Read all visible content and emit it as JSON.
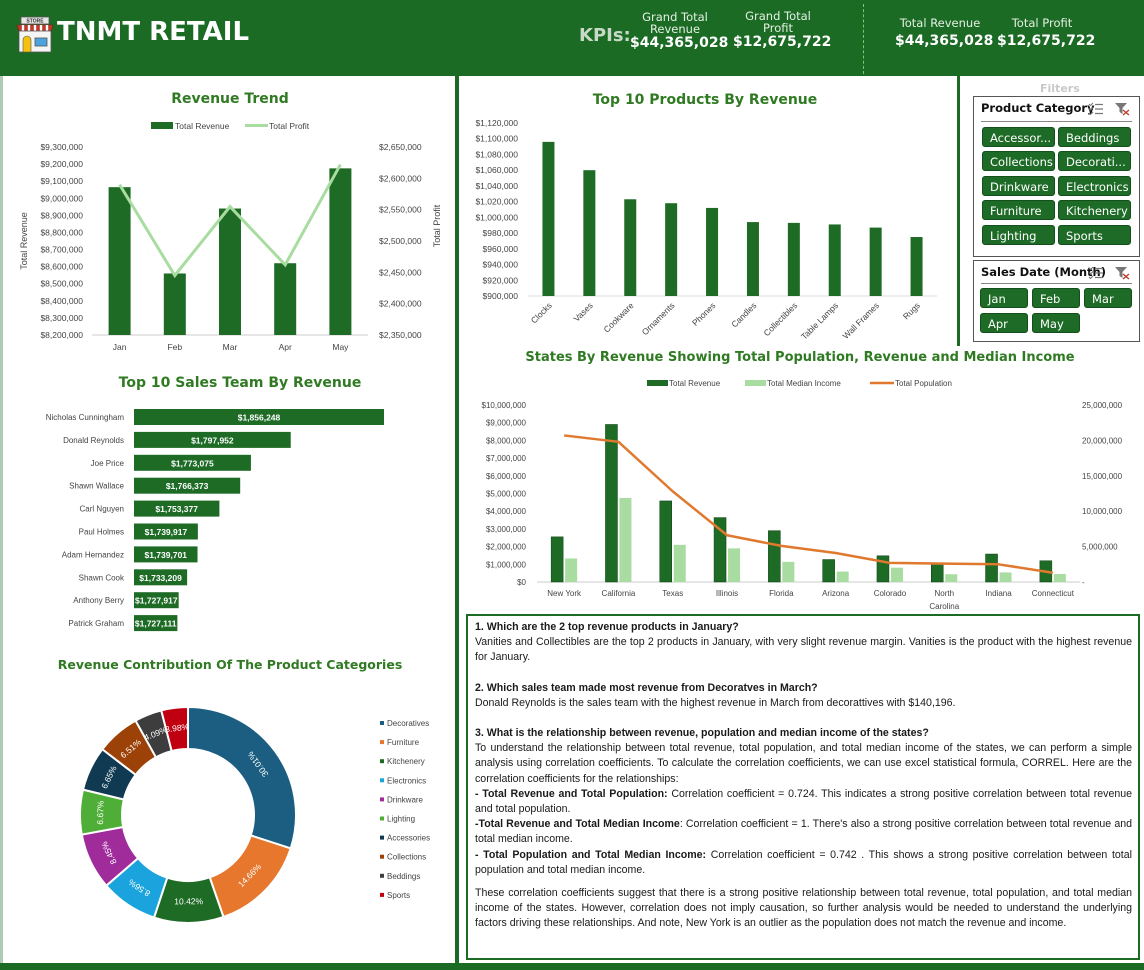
{
  "header": {
    "brand": "TNMT RETAIL",
    "logo_icon": "store-icon",
    "kpis_label": "KPIs:",
    "kpis": [
      {
        "label_line1": "Grand Total",
        "label_line2": "Revenue",
        "value": "$44,365,028"
      },
      {
        "label_line1": "Grand Total",
        "label_line2": "Profit",
        "value": "$12,675,722"
      },
      {
        "label_line1": "Total Revenue",
        "label_line2": "",
        "value": "$44,365,028"
      },
      {
        "label_line1": "Total Profit",
        "label_line2": "",
        "value": "$12,675,722"
      }
    ]
  },
  "colors": {
    "brand_green": "#1b6b24",
    "bar_green": "#1e6b26",
    "light_green": "#a8dca0",
    "orange_line": "#e0792e",
    "title_green": "#2f7a22"
  },
  "filters": {
    "title": "Filters",
    "product_category": {
      "title": "Product Category",
      "items": [
        "Accessor...",
        "Beddings",
        "Collections",
        "Decorati...",
        "Drinkware",
        "Electronics",
        "Furniture",
        "Kitchenery",
        "Lighting",
        "Sports"
      ]
    },
    "sales_date": {
      "title": "Sales Date (Month)",
      "items": [
        "Jan",
        "Feb",
        "Mar",
        "Apr",
        "May"
      ]
    }
  },
  "chart_data": [
    {
      "id": "revenue_trend",
      "type": "bar",
      "title": "Revenue Trend",
      "categories": [
        "Jan",
        "Feb",
        "Mar",
        "Apr",
        "May"
      ],
      "series": [
        {
          "name": "Total Revenue",
          "kind": "bar",
          "axis": "left",
          "values": [
            9065000,
            8560000,
            8940000,
            8620000,
            9175000
          ]
        },
        {
          "name": "Total Profit",
          "kind": "line",
          "axis": "right",
          "values": [
            2590000,
            2445000,
            2555000,
            2462000,
            2622000
          ]
        }
      ],
      "ylabel": "Total Revenue",
      "y2label": "Total Profit",
      "ylim": [
        8200000,
        9300000
      ],
      "yticks": [
        "$9,300,000",
        "$9,200,000",
        "$9,100,000",
        "$9,000,000",
        "$8,900,000",
        "$8,800,000",
        "$8,700,000",
        "$8,600,000",
        "$8,500,000",
        "$8,400,000",
        "$8,300,000",
        "$8,200,000"
      ],
      "y2lim": [
        2350000,
        2650000
      ],
      "y2ticks": [
        "$2,650,000",
        "$2,600,000",
        "$2,550,000",
        "$2,500,000",
        "$2,450,000",
        "$2,400,000",
        "$2,350,000"
      ],
      "legend": "top"
    },
    {
      "id": "top_products",
      "type": "bar",
      "title": "Top 10 Products By Revenue",
      "categories": [
        "Clocks",
        "Vases",
        "Cookware",
        "Ornaments",
        "Phones",
        "Candles",
        "Collectibles",
        "Table Lamps",
        "Wall Frames",
        "Rugs"
      ],
      "values": [
        1096000,
        1060000,
        1023000,
        1018000,
        1012000,
        994000,
        993000,
        991000,
        987000,
        975000
      ],
      "ylim": [
        900000,
        1120000
      ],
      "yticks": [
        "$1,120,000",
        "$1,100,000",
        "$1,080,000",
        "$1,060,000",
        "$1,040,000",
        "$1,020,000",
        "$1,000,000",
        "$980,000",
        "$960,000",
        "$940,000",
        "$920,000",
        "$900,000"
      ]
    },
    {
      "id": "top_sales_team",
      "type": "bar",
      "orientation": "horizontal",
      "title": "Top 10 Sales Team By Revenue",
      "categories": [
        "Nicholas Cunningham",
        "Donald Reynolds",
        "Joe Price",
        "Shawn Wallace",
        "Carl Nguyen",
        "Paul Holmes",
        "Adam Hernandez",
        "Shawn Cook",
        "Anthony Berry",
        "Patrick Graham"
      ],
      "values": [
        1856248,
        1797952,
        1773075,
        1766373,
        1753377,
        1739917,
        1739701,
        1733209,
        1727917,
        1727111
      ],
      "labels": [
        "$1,856,248",
        "$1,797,952",
        "$1,773,075",
        "$1,766,373",
        "$1,753,377",
        "$1,739,917",
        "$1,739,701",
        "$1,733,209",
        "$1,727,917",
        "$1,727,111"
      ],
      "xlim": [
        1700000,
        1860000
      ]
    },
    {
      "id": "states",
      "type": "bar",
      "title": "States By Revenue Showing Total Population, Revenue and Median Income",
      "categories": [
        "New York",
        "California",
        "Texas",
        "Illinois",
        "Florida",
        "Arizona",
        "Colorado",
        "North Carolina",
        "Indiana",
        "Connecticut"
      ],
      "series": [
        {
          "name": "Total Revenue",
          "kind": "bar",
          "axis": "left",
          "values": [
            2550000,
            8900000,
            4580000,
            3640000,
            2900000,
            1270000,
            1480000,
            1050000,
            1580000,
            1200000
          ]
        },
        {
          "name": "Total Median Income",
          "kind": "bar",
          "axis": "left",
          "values": [
            1330000,
            4750000,
            2100000,
            1900000,
            1140000,
            590000,
            810000,
            440000,
            540000,
            450000
          ]
        },
        {
          "name": "Total Population",
          "kind": "line",
          "axis": "right",
          "values": [
            20700000,
            19800000,
            12800000,
            6600000,
            5100000,
            4100000,
            2700000,
            2600000,
            2500000,
            1300000
          ]
        }
      ],
      "ylim": [
        0,
        10000000
      ],
      "yticks": [
        "$10,000,000",
        "$9,000,000",
        "$8,000,000",
        "$7,000,000",
        "$6,000,000",
        "$5,000,000",
        "$4,000,000",
        "$3,000,000",
        "$2,000,000",
        "$1,000,000",
        "$0"
      ],
      "y2lim": [
        0,
        25000000
      ],
      "y2ticks": [
        "25,000,000",
        "20,000,000",
        "15,000,000",
        "10,000,000",
        "5,000,000",
        "-"
      ],
      "legend": "top"
    },
    {
      "id": "category_contribution",
      "type": "pie",
      "donut": true,
      "title": "Revenue Contribution Of The Product Categories",
      "categories": [
        "Decoratives",
        "Furniture",
        "Kitchenery",
        "Electronics",
        "Drinkware",
        "Lighting",
        "Accessories",
        "Collections",
        "Beddings",
        "Sports"
      ],
      "values": [
        30.01,
        14.66,
        10.42,
        8.56,
        8.45,
        6.67,
        6.65,
        6.51,
        4.09,
        3.98
      ],
      "labels": [
        "30.01%",
        "14.66%",
        "10.42%",
        "8.56%",
        "8.45%",
        "6.67%",
        "6.65%",
        "6.51%",
        "4.09%",
        "3.98%"
      ],
      "colors": [
        "#1b5e82",
        "#e8772e",
        "#1e6b26",
        "#1aa3dd",
        "#a02b9b",
        "#4fae37",
        "#0f3a52",
        "#9c4208",
        "#3d3d3d",
        "#c00010"
      ],
      "legend": "right"
    }
  ],
  "notes": {
    "q1": "1. Which are the 2 top revenue products in January?",
    "a1": "Vanities and Collectibles are the top 2 products in January, with very slight revenue margin. Vanities is the product with the highest revenue for January.",
    "q2": "2. Which sales team made most revenue from Decoratves in March?",
    "a2": "Donald Reynolds is the sales team with the highest revenue in March from decorattives with $140,196.",
    "q3": "3. What is the relationship between revenue, population and median income of the states?",
    "a3_intro": "To understand the relationship between total revenue, total population, and total median income of the states, we can perform a simple analysis using correlation coefficients. To calculate the correlation coefficients, we can use excel statistical formula, CORREL. Here are the correlation coefficients for the relationships:",
    "c1_label": "- Total Revenue and Total Population:",
    "c1_text": "  Correlation coefficient = 0.724. This indicates a strong positive correlation between total revenue and total population.",
    "c2_label": "-Total Revenue and Total Median Income",
    "c2_text": ":  Correlation coefficient = 1. There's also a strong positive correlation between total revenue and total median income.",
    "c3_label": "- Total Population and Total Median Income:",
    "c3_text": "  Correlation coefficient = 0.742 . This shows a strong positive correlation between total population and total median income.",
    "conclusion": "These correlation coefficients suggest that there is a strong positive relationship between total revenue, total population, and total median income of the states. However, correlation does not imply causation, so further analysis would be needed to understand the underlying factors driving these relationships. And note, New York is an outlier as the population does not match the revenue and income."
  }
}
